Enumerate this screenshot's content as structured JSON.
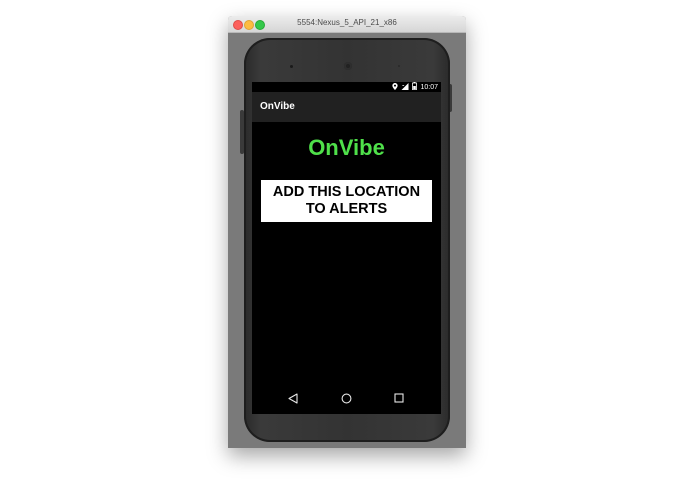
{
  "window": {
    "title": "5554:Nexus_5_API_21_x86"
  },
  "statusbar": {
    "time": "10:07",
    "icons": [
      "location-icon",
      "signal-icon",
      "battery-icon"
    ]
  },
  "app": {
    "title": "OnVibe",
    "brand": "OnVibe",
    "brand_color": "#4fe04a",
    "add_button": {
      "line1": "ADD THIS LOCATION",
      "line2": "TO ALERTS"
    }
  },
  "navbar": {
    "icons": [
      "back-icon",
      "home-icon",
      "recents-icon"
    ]
  }
}
